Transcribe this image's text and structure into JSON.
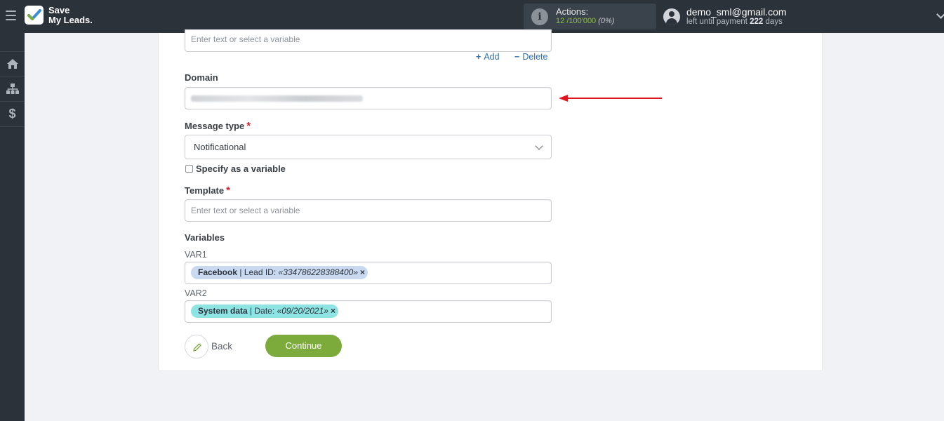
{
  "app": {
    "logo_line1": "Save",
    "logo_line2": "My Leads.",
    "brand_color": "#2b323a"
  },
  "header": {
    "actions_label": "Actions:",
    "actions_used": "12",
    "actions_total": "/100'000",
    "actions_percent": "(0%)",
    "user_email": "demo_sml@gmail.com",
    "payment_prefix": "left until payment",
    "payment_days": "222",
    "payment_suffix": "days"
  },
  "sidebar": {
    "items": [
      {
        "icon": "home-icon"
      },
      {
        "icon": "sitemap-icon"
      },
      {
        "icon": "dollar-icon"
      }
    ]
  },
  "form": {
    "prev_field_placeholder": "Enter text or select a variable",
    "add_label": "Add",
    "delete_label": "Delete",
    "domain_label": "Domain",
    "message_type_label": "Message type",
    "message_type_value": "Notificational",
    "specify_variable_label": "Specify as a variable",
    "template_label": "Template",
    "template_placeholder": "Enter text or select a variable",
    "variables_label": "Variables",
    "var1_label": "VAR1",
    "var1_tag": {
      "source": "Facebook",
      "field": "Lead ID:",
      "value": "«334786228388400»"
    },
    "var2_label": "VAR2",
    "var2_tag": {
      "source": "System data",
      "field": "Date:",
      "value": "«09/20/2021»"
    },
    "back_label": "Back",
    "continue_label": "Continue",
    "required_mark": "*"
  },
  "colors": {
    "accent_green": "#7cab3c",
    "link_blue": "#2d6fb0",
    "required_red": "#d4202a",
    "annotation_arrow": "#e0141e"
  }
}
